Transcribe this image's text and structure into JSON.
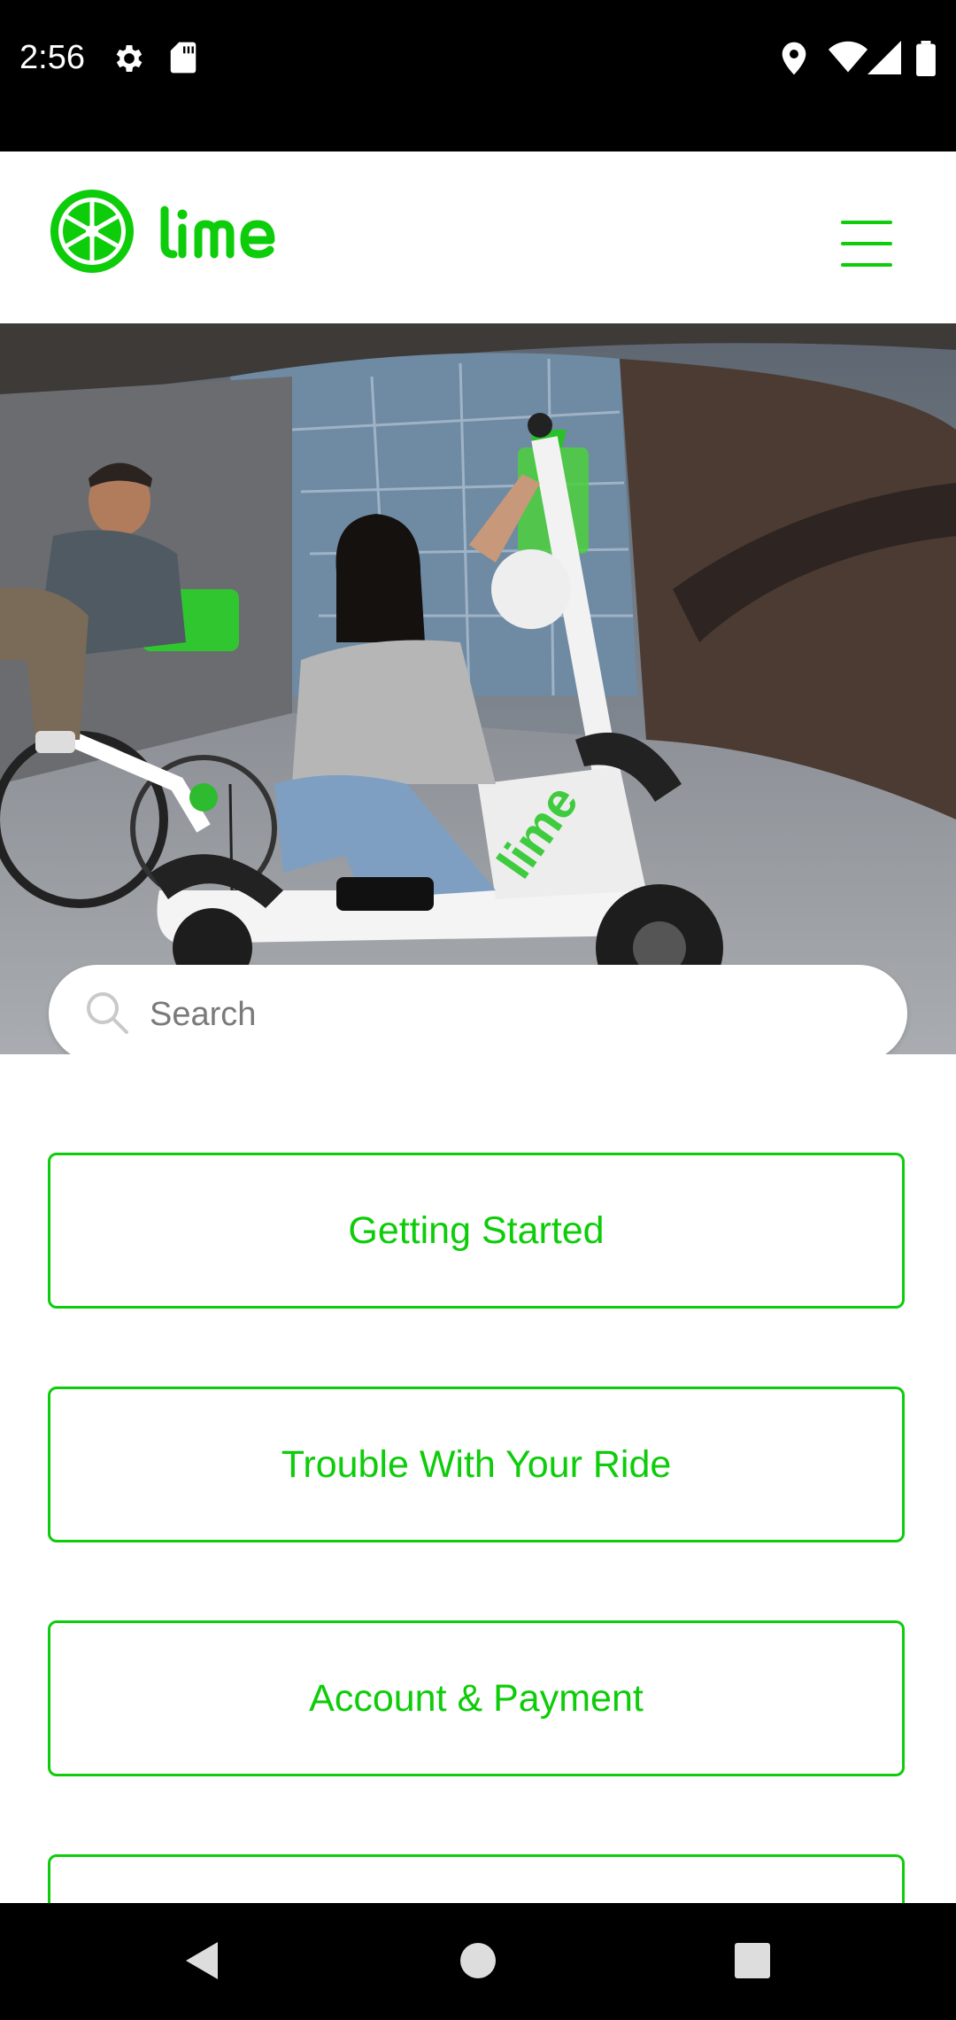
{
  "status_bar": {
    "time": "2:56",
    "icons": [
      "settings-icon",
      "sd-card-icon",
      "location-icon",
      "wifi-icon",
      "signal-icon",
      "battery-icon"
    ]
  },
  "header": {
    "brand": "Lime",
    "menu_icon": "hamburger-menu-icon",
    "accent_color": "#0DCC09"
  },
  "search": {
    "placeholder": "Search",
    "value": ""
  },
  "categories": [
    {
      "label": "Getting Started"
    },
    {
      "label": "Trouble With Your Ride"
    },
    {
      "label": "Account & Payment"
    },
    {
      "label": ""
    }
  ],
  "nav_bar": {
    "icons": [
      "back-icon",
      "home-icon",
      "recents-icon"
    ]
  }
}
